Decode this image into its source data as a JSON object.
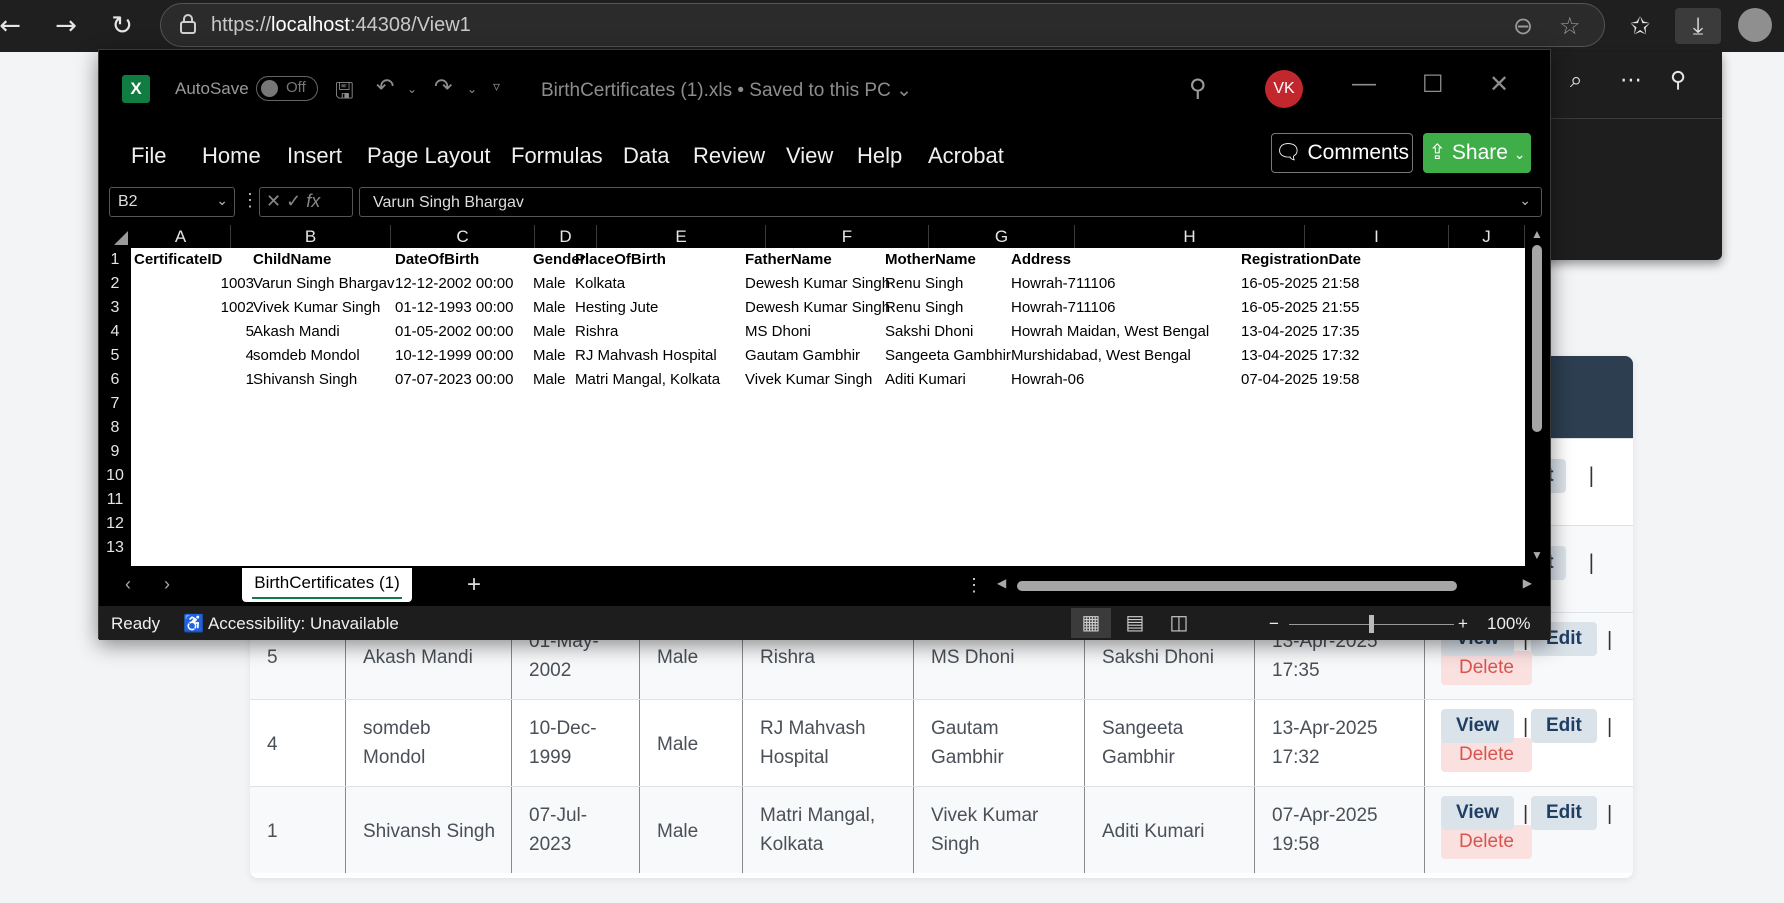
{
  "browser": {
    "url_prefix": "https://",
    "url_host": "localhost",
    "url_rest": ":44308/View1"
  },
  "web_table": {
    "rows": [
      {
        "id": "5",
        "name": [
          "Akash Mandi",
          ""
        ],
        "dob": [
          "01-May-",
          "2002"
        ],
        "gender": "Male",
        "place": [
          "Rishra",
          ""
        ],
        "father": [
          "MS Dhoni",
          ""
        ],
        "mother": [
          "Sakshi Dhoni",
          ""
        ],
        "reg": [
          "13-Apr-2025",
          "17:35"
        ]
      },
      {
        "id": "4",
        "name": [
          "somdeb",
          "Mondol"
        ],
        "dob": [
          "10-Dec-",
          "1999"
        ],
        "gender": "Male",
        "place": [
          "RJ Mahvash",
          "Hospital"
        ],
        "father": [
          "Gautam",
          "Gambhir"
        ],
        "mother": [
          "Sangeeta",
          "Gambhir"
        ],
        "reg": [
          "13-Apr-2025",
          "17:32"
        ]
      },
      {
        "id": "1",
        "name": [
          "Shivansh Singh",
          ""
        ],
        "dob": [
          "07-Jul-",
          "2023"
        ],
        "gender": "Male",
        "place": [
          "Matri Mangal,",
          "Kolkata"
        ],
        "father": [
          "Vivek Kumar",
          "Singh"
        ],
        "mother": [
          "Aditi Kumari",
          ""
        ],
        "reg": [
          "07-Apr-2025",
          "19:58"
        ]
      }
    ],
    "view_label": "View",
    "edit_label": "Edit",
    "delete_label": "Delete",
    "partial_edit": "it"
  },
  "excel": {
    "autosave_label": "AutoSave",
    "autosave_state": "Off",
    "doc_title": "BirthCertificates (1).xls • Saved to this PC",
    "user_initials": "VK",
    "tabs": [
      "File",
      "Home",
      "Insert",
      "Page Layout",
      "Formulas",
      "Data",
      "Review",
      "View",
      "Help",
      "Acrobat"
    ],
    "comments_label": "Comments",
    "share_label": "Share",
    "name_box": "B2",
    "formula_value": "Varun Singh Bhargav",
    "columns": [
      "A",
      "B",
      "C",
      "D",
      "E",
      "F",
      "G",
      "H",
      "I",
      "J"
    ],
    "row_numbers": [
      "1",
      "2",
      "3",
      "4",
      "5",
      "6",
      "7",
      "8",
      "9",
      "10",
      "11",
      "12",
      "13"
    ],
    "headers": [
      "CertificateID",
      "ChildName",
      "DateOfBirth",
      "Gender",
      "PlaceOfBirth",
      "FatherName",
      "MotherName",
      "Address",
      "RegistrationDate"
    ],
    "rows": [
      [
        "1003",
        "Varun Singh Bhargav",
        "12-12-2002 00:00",
        "Male",
        "Kolkata",
        "Dewesh Kumar Singh",
        "Renu Singh",
        "Howrah-711106",
        "16-05-2025 21:58"
      ],
      [
        "1002",
        "Vivek Kumar Singh",
        "01-12-1993 00:00",
        "Male",
        "Hesting Jute",
        "Dewesh Kumar Singh",
        "Renu Singh",
        "Howrah-711106",
        "16-05-2025 21:55"
      ],
      [
        "5",
        "Akash Mandi",
        "01-05-2002 00:00",
        "Male",
        "Rishra",
        "MS Dhoni",
        "Sakshi Dhoni",
        "Howrah Maidan, West Bengal",
        "13-04-2025 17:35"
      ],
      [
        "4",
        "somdeb Mondol",
        "10-12-1999 00:00",
        "Male",
        "RJ Mahvash Hospital",
        "Gautam Gambhir",
        "Sangeeta Gambhir",
        "Murshidabad, West Bengal",
        "13-04-2025 17:32"
      ],
      [
        "1",
        "Shivansh Singh",
        "07-07-2023 00:00",
        "Male",
        "Matri Mangal, Kolkata",
        "Vivek Kumar Singh",
        "Aditi Kumari",
        "Howrah-06",
        "07-04-2025 19:58"
      ]
    ],
    "sheet_tab": "BirthCertificates (1)",
    "status_ready": "Ready",
    "status_accessibility": "Accessibility: Unavailable",
    "zoom_minus": "−",
    "zoom_plus": "+",
    "zoom_level": "100%",
    "zoom_fraction": 0.5
  }
}
